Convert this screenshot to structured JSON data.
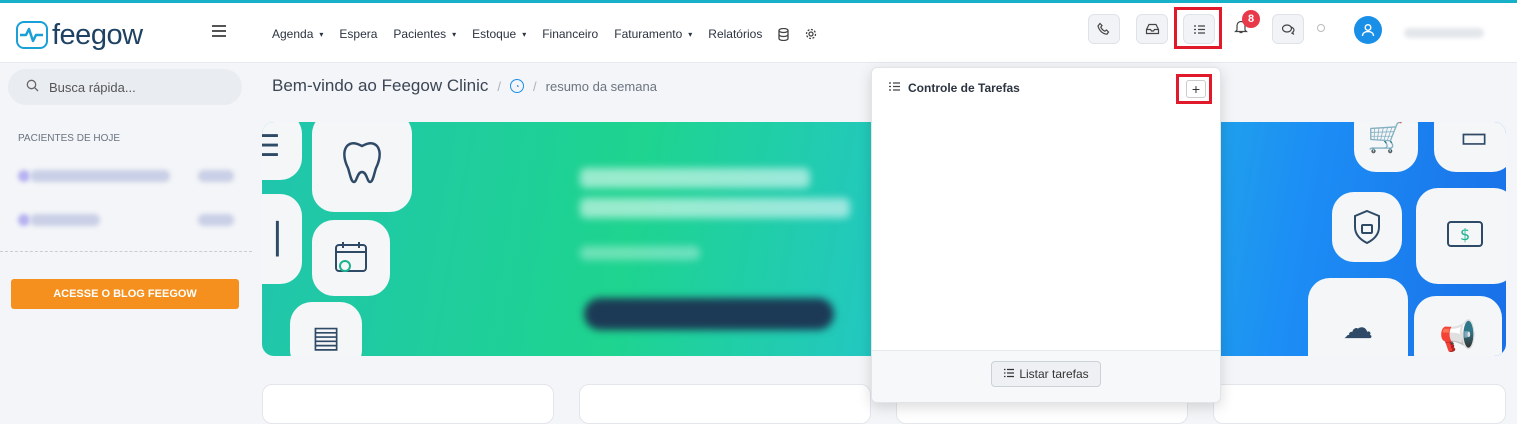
{
  "brand": {
    "name": "feegow",
    "color": "#1a9fd6"
  },
  "accent_line_color": "#17b0c9",
  "nav": [
    {
      "label": "Agenda",
      "dropdown": true
    },
    {
      "label": "Espera",
      "dropdown": false
    },
    {
      "label": "Pacientes",
      "dropdown": true
    },
    {
      "label": "Estoque",
      "dropdown": true
    },
    {
      "label": "Financeiro",
      "dropdown": false
    },
    {
      "label": "Faturamento",
      "dropdown": true
    },
    {
      "label": "Relatórios",
      "dropdown": false
    }
  ],
  "nav_caret": "▾",
  "toolbar": {
    "icons": [
      "phone-icon",
      "inbox-icon",
      "task-list-icon",
      "bell-icon",
      "chat-icon",
      "status-dot-icon",
      "user-avatar-icon"
    ],
    "notification_count": "8",
    "notification_color": "#e8394a"
  },
  "sidebar": {
    "search_placeholder": "Busca rápida...",
    "section_title": "PACIENTES DE HOJE",
    "blog_button": "ACESSE O BLOG FEEGOW",
    "blog_color": "#f5901e"
  },
  "breadcrumb": {
    "title": "Bem-vindo ao Feegow Clinic",
    "separator": "/",
    "current": "resumo da semana"
  },
  "tasks_popup": {
    "title": "Controle de Tarefas",
    "add_label": "+",
    "list_button": "Listar tarefas"
  },
  "highlight_color": "#e0192b"
}
